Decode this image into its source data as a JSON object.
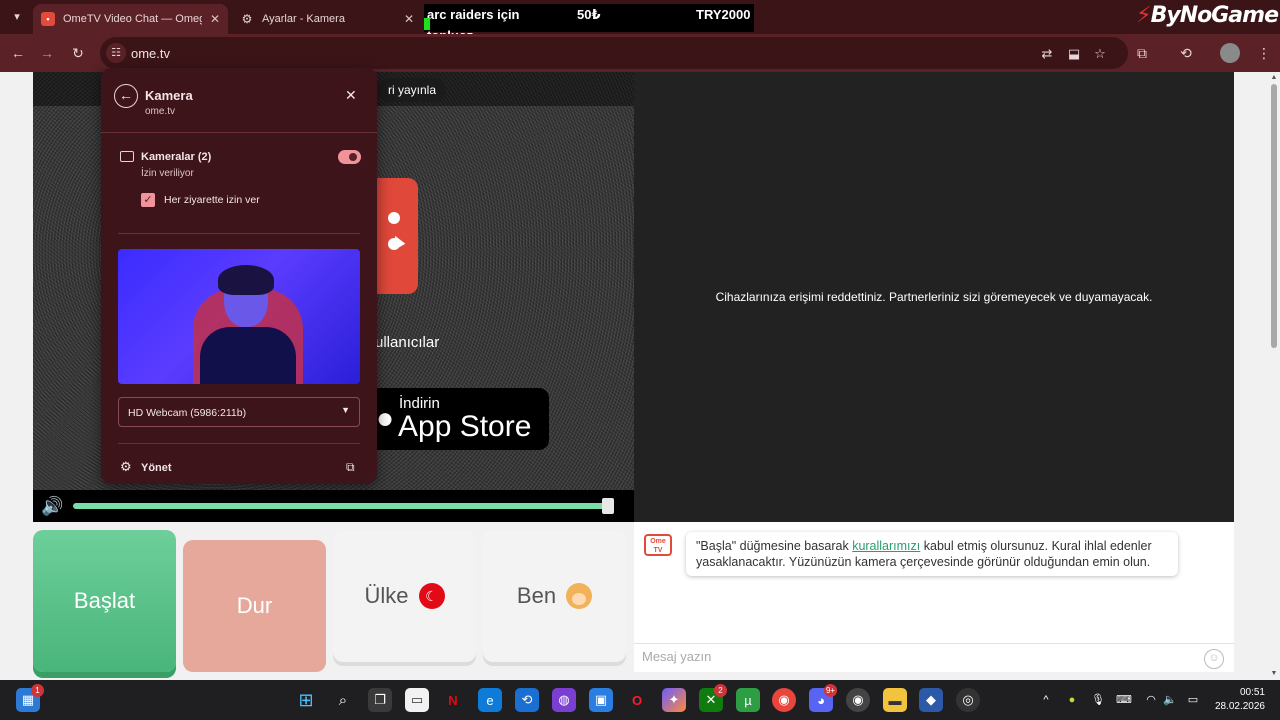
{
  "browser": {
    "tabs": [
      {
        "title": "OmeTV Video Chat — Omegle",
        "active": true,
        "icon": "ometv-favicon"
      },
      {
        "title": "Ayarlar - Kamera",
        "active": false,
        "icon": "gear-icon"
      }
    ],
    "url": "ome.tv"
  },
  "overlay_ad": {
    "line1_a": "arc raiders için",
    "line1_b": "50₺",
    "line1_c": "TRY2000",
    "line2": "topluoz",
    "brand": "ByNoGame"
  },
  "camera_popup": {
    "title": "Kamera",
    "site": "ome.tv",
    "cameras_label": "Kameralar (2)",
    "cameras_status": "İzin veriliyor",
    "allow_every_visit": "Her ziyarette izin ver",
    "selected_camera": "HD Webcam (5986:211b)",
    "manage": "Yönet"
  },
  "video": {
    "stream_pill": "ri yayınla",
    "users_text": "ullanıcılar",
    "appstore_small": "İndirin",
    "appstore_big": "App Store",
    "volume_level": 0.99,
    "denied_message": "Cihazlarınıza erişimi reddettiniz. Partnerleriniz sizi göremeyecek ve duyamayacak."
  },
  "controls": {
    "start": "Başlat",
    "stop": "Dur",
    "country": "Ülke",
    "me": "Ben"
  },
  "chat": {
    "logo_text": "Ome TV",
    "message_before": "\"Başla\" düğmesine basarak ",
    "message_link": "kurallarımızı",
    "message_after": " kabul etmiş olursunuz. Kural ihlal edenler yasaklanacaktır. Yüzünüzün kamera çerçevesinde görünür olduğundan emin olun.",
    "input_placeholder": "Mesaj yazın"
  },
  "taskbar": {
    "time": "00:51",
    "date": "28.02.2026",
    "widgets_badge": "1",
    "xbox_badge": "2",
    "discord_badge": "9+"
  }
}
